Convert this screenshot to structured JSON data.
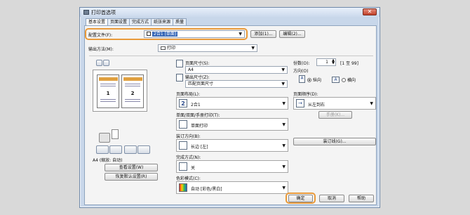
{
  "window": {
    "title": "打印首选项",
    "close": "✕"
  },
  "tabs": [
    {
      "label": "基本设置"
    },
    {
      "label": "页面设置"
    },
    {
      "label": "完成方式"
    },
    {
      "label": "纸张来源"
    },
    {
      "label": "质量"
    }
  ],
  "profile": {
    "label": "配置文件(F):",
    "value": "2合1 [单面]",
    "add_label": "添加(1)...",
    "edit_label": "编辑(2)..."
  },
  "output": {
    "label": "输出方法(M):",
    "value": "打印"
  },
  "page_size": {
    "label": "页面尺寸(S):",
    "value": "A4"
  },
  "output_size": {
    "label": "输出尺寸(Z):",
    "value": "匹配页面尺寸"
  },
  "layout": {
    "label": "页面布局(L):",
    "value": "2合1",
    "icon_text": "2"
  },
  "duplex": {
    "label": "单面/双面/手册打印(T):",
    "value": "单面打印"
  },
  "binding": {
    "label": "装订方向(B):",
    "value": "长边 [左]"
  },
  "finishing": {
    "label": "完成方式(N):",
    "value": "关"
  },
  "color_mode": {
    "label": "色彩模式(C):",
    "value": "自动 [彩色/黑白]"
  },
  "copies": {
    "label": "份数(O):",
    "value": "1",
    "range": "[1 至 99]"
  },
  "orientation": {
    "label": "方向(O)",
    "options": [
      {
        "label": "纵向",
        "icon": "A",
        "selected": true
      },
      {
        "label": "横向",
        "icon": "A",
        "selected": false
      }
    ]
  },
  "page_order": {
    "label": "页面顺序(D):",
    "value": "从左到右",
    "manual_label": "手册(K)..."
  },
  "binding_margin": {
    "label": "装订线(G)..."
  },
  "preview": {
    "page_numbers": [
      "1",
      "2"
    ],
    "status": "A4 (缩放: 自动)",
    "view_settings": "查看设置(W)",
    "restore_defaults": "恢复默认设置(R)"
  },
  "footer": {
    "ok": "确定",
    "cancel": "取消",
    "help": "帮助"
  },
  "colors": {
    "highlight": "#e99a3a",
    "selection": "#3768b8"
  }
}
